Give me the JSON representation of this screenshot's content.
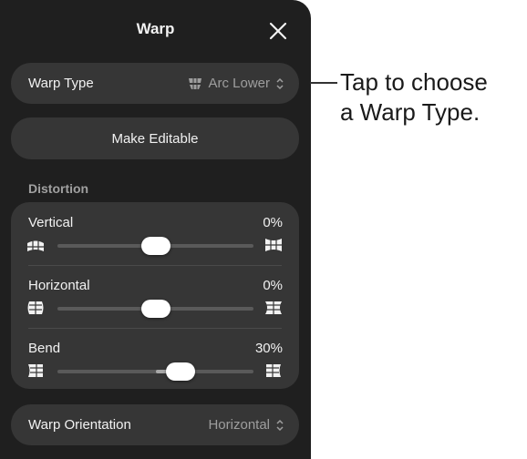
{
  "panel": {
    "title": "Warp",
    "close_icon": "close-icon"
  },
  "warp_type": {
    "label": "Warp Type",
    "value": "Arc Lower",
    "icon": "arc-lower-icon",
    "chevron": "up-down-chevron-icon"
  },
  "make_editable": {
    "label": "Make Editable"
  },
  "distortion": {
    "section_label": "Distortion",
    "sliders": [
      {
        "label": "Vertical",
        "value_text": "0%",
        "level": 0.5,
        "left_icon": "vertical-compress-icon",
        "right_icon": "vertical-expand-icon"
      },
      {
        "label": "Horizontal",
        "value_text": "0%",
        "level": 0.5,
        "left_icon": "horizontal-compress-icon",
        "right_icon": "horizontal-expand-icon"
      },
      {
        "label": "Bend",
        "value_text": "30%",
        "level": 0.63,
        "left_icon": "bend-left-icon",
        "right_icon": "bend-right-icon"
      }
    ]
  },
  "warp_orientation": {
    "label": "Warp Orientation",
    "value": "Horizontal",
    "chevron": "up-down-chevron-icon"
  },
  "callout": {
    "line1": "Tap to choose",
    "line2": "a Warp Type."
  },
  "colors": {
    "panel_bg": "#1f1f1f",
    "row_bg": "#363636",
    "text": "#f2f2f2",
    "secondary_text": "#9e9e9e"
  }
}
